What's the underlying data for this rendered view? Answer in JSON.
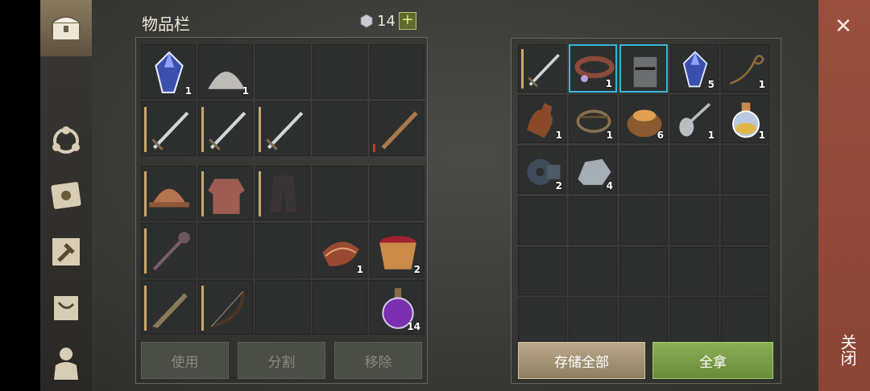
{
  "header": {
    "title": "物品栏",
    "gem_count": "14",
    "plus_label": "+"
  },
  "left_grid": {
    "rows": [
      [
        {
          "icon": "crystal-icon",
          "count": "1"
        },
        {
          "icon": "powder-pile-icon",
          "count": "1"
        },
        {},
        {},
        {}
      ],
      [
        {
          "icon": "sword-icon",
          "dur": true
        },
        {
          "icon": "sword-icon",
          "dur": true
        },
        {
          "icon": "sword-icon",
          "dur": true
        },
        {},
        {
          "icon": "wooden-sword-icon",
          "dur": true,
          "red": true
        }
      ],
      [
        {
          "icon": "helmet-icon",
          "dur": true
        },
        {
          "icon": "chainmail-icon",
          "dur": true
        },
        {
          "icon": "trousers-icon",
          "dur": true
        },
        {},
        {}
      ],
      [
        {
          "icon": "mace-icon",
          "dur": true
        },
        {},
        {},
        {
          "icon": "meat-icon",
          "count": "1"
        },
        {
          "icon": "berry-bowl-icon",
          "count": "2"
        }
      ],
      [
        {
          "icon": "blade-icon",
          "dur": true
        },
        {
          "icon": "bow-icon",
          "dur": true
        },
        {},
        {},
        {
          "icon": "potion-icon",
          "count": "14"
        }
      ]
    ]
  },
  "right_grid": {
    "rows": [
      [
        {
          "icon": "sword-icon",
          "dur": true
        },
        {
          "icon": "collar-icon",
          "count": "1",
          "sel": true
        },
        {
          "icon": "knight-helmet-icon",
          "sel": true
        },
        {
          "icon": "crystal-icon",
          "count": "5"
        },
        {
          "icon": "rope-icon",
          "count": "1"
        }
      ],
      [
        {
          "icon": "bottle-icon",
          "count": "1"
        },
        {
          "icon": "trap-icon",
          "count": "1"
        },
        {
          "icon": "grain-sack-icon",
          "count": "6"
        },
        {
          "icon": "spoon-icon",
          "count": "1"
        },
        {
          "icon": "flask-icon",
          "count": "1"
        }
      ],
      [
        {
          "icon": "gear-part-icon",
          "count": "2"
        },
        {
          "icon": "ore-icon",
          "count": "4"
        },
        {},
        {},
        {}
      ],
      [
        {},
        {},
        {},
        {},
        {}
      ],
      [
        {},
        {},
        {},
        {},
        {}
      ],
      [
        {},
        {},
        {},
        {},
        {}
      ]
    ]
  },
  "actions": {
    "use": "使用",
    "split": "分割",
    "remove": "移除",
    "store_all": "存储全部",
    "take_all": "全拿"
  },
  "close": {
    "x": "✕",
    "label": "关闭"
  },
  "colors": {
    "accent_green": "#7ea04a",
    "close_bg": "#944b3a",
    "select_blue": "#39b3d8"
  }
}
